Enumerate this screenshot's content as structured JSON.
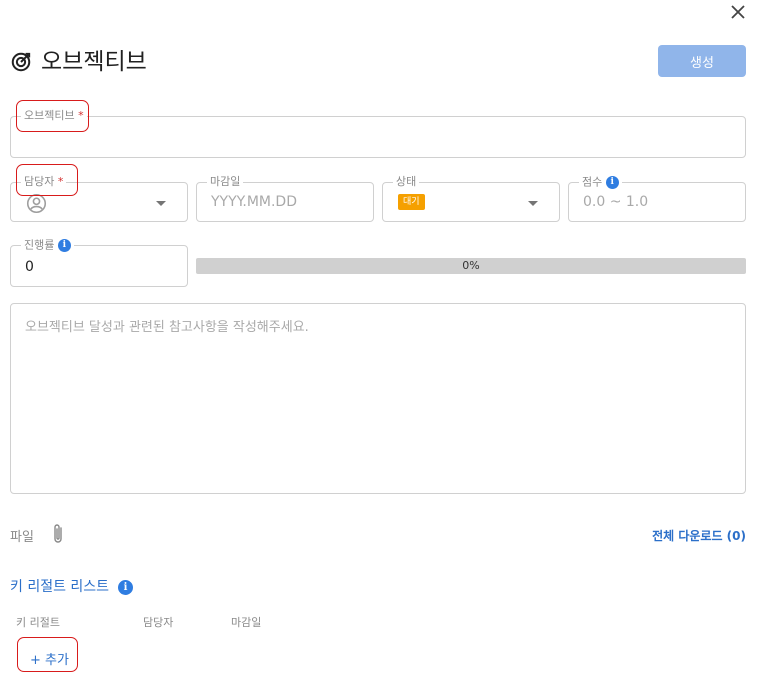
{
  "header": {
    "title": "오브젝티브",
    "create_label": "생성",
    "close_icon": "close-icon",
    "title_icon": "target-icon"
  },
  "fields": {
    "objective": {
      "label": "오브젝티브",
      "required_mark": "*",
      "value": ""
    },
    "assignee": {
      "label": "담당자",
      "required_mark": "*",
      "icon": "user-circle-icon"
    },
    "due_date": {
      "label": "마감일",
      "placeholder": "YYYY.MM.DD"
    },
    "status": {
      "label": "상태",
      "value": "대기",
      "badge_color": "#f5a000"
    },
    "score": {
      "label": "점수",
      "placeholder": "0.0 ~ 1.0"
    },
    "progress": {
      "label": "진행률",
      "value": "0"
    }
  },
  "progress_bar": {
    "percent_text": "0%",
    "fraction": 0
  },
  "note": {
    "placeholder": "오브젝티브 달성과 관련된 참고사항을 작성해주세요."
  },
  "files": {
    "label": "파일",
    "download_all": "전체 다운로드 (0)"
  },
  "key_results": {
    "title": "키 리절트 리스트",
    "columns": [
      "키 리절트",
      "담당자",
      "마감일"
    ],
    "add_label": "+ 추가"
  },
  "colors": {
    "accent": "#2b6fc9",
    "create_button": "#90b5ea",
    "required_highlight": "#d81b1b",
    "info_icon": "#2f7de1"
  }
}
